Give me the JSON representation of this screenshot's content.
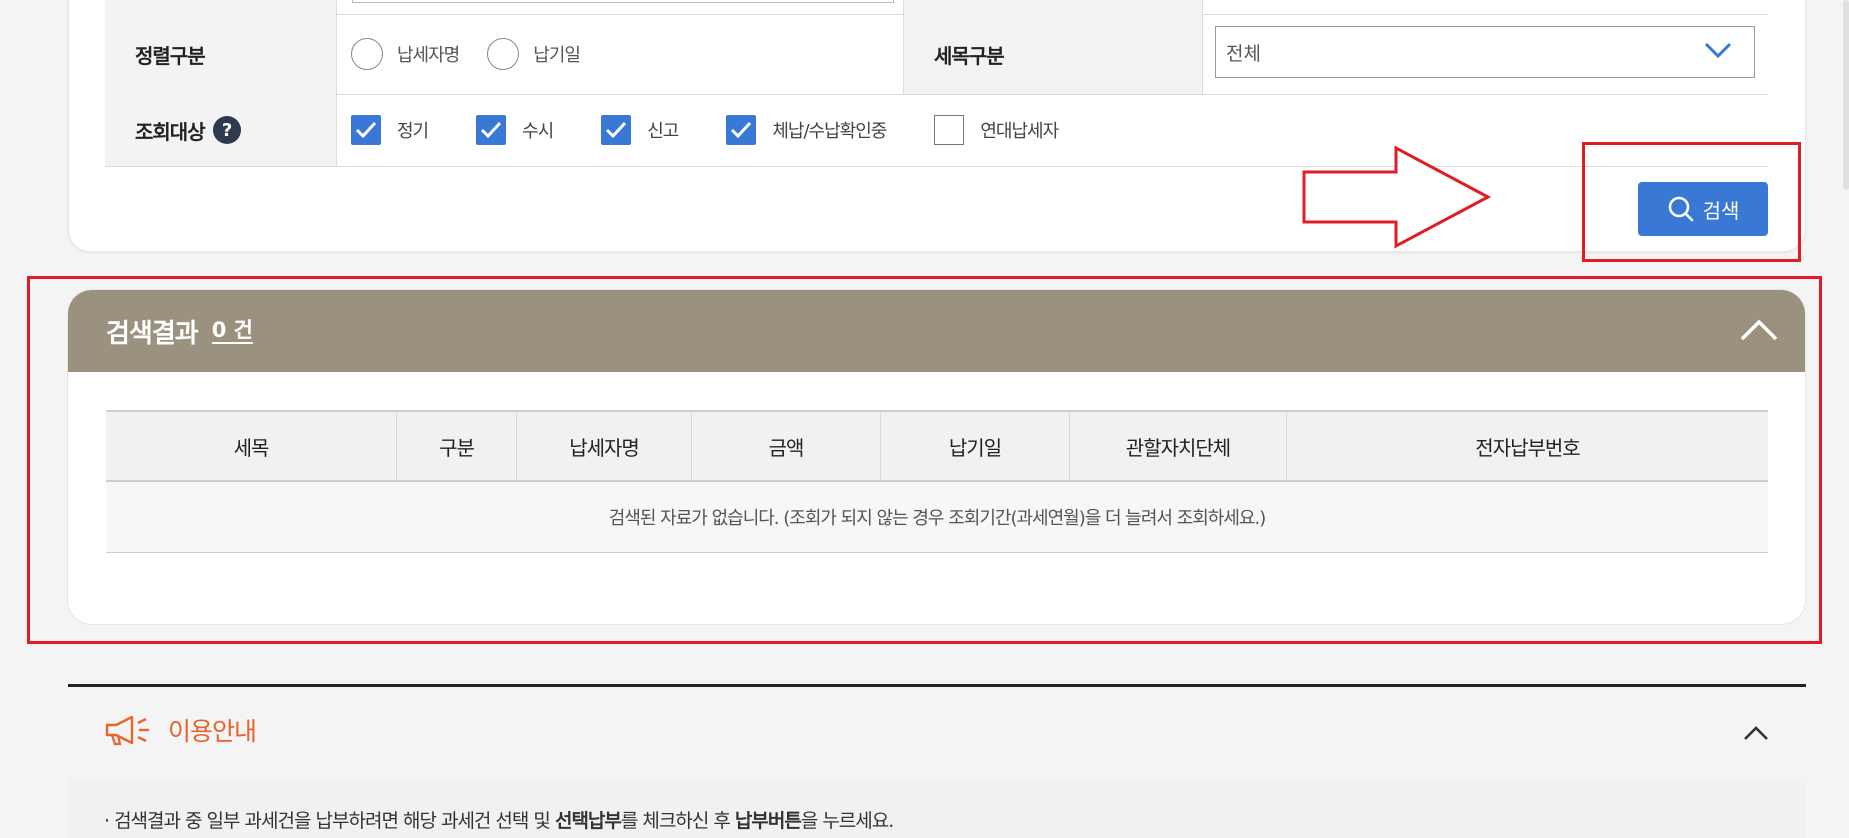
{
  "search_form": {
    "sort": {
      "label": "정렬구분",
      "options": [
        "납세자명",
        "납기일"
      ]
    },
    "tax_item": {
      "label": "세목구분",
      "selected": "전체"
    },
    "targets": {
      "label": "조회대상",
      "help_glyph": "?",
      "items": [
        {
          "label": "정기",
          "checked": true
        },
        {
          "label": "수시",
          "checked": true
        },
        {
          "label": "신고",
          "checked": true
        },
        {
          "label": "체납/수납확인중",
          "checked": true
        },
        {
          "label": "연대납세자",
          "checked": false
        }
      ]
    },
    "search_button": "검색"
  },
  "results": {
    "title": "검색결과",
    "count": "0 건",
    "columns": [
      "세목",
      "구분",
      "납세자명",
      "금액",
      "납기일",
      "관할자치단체",
      "전자납부번호"
    ],
    "empty_message": "검색된 자료가 없습니다. (조회가 되지 않는 경우 조회기간(과세연월)을 더 늘려서 조회하세요.)"
  },
  "guide": {
    "title": "이용안내",
    "text_parts": [
      "· 검색결과 중 일부 과세건을 납부하려면 해당 과세건 선택 및 ",
      "선택납부",
      "를 체크하신 후 ",
      "납부버튼",
      "을 누르세요."
    ]
  },
  "colors": {
    "accent": "#3a78d6",
    "result_header": "#9b917f",
    "annotation_red": "#e01c24",
    "guide_orange": "#e8642b"
  }
}
